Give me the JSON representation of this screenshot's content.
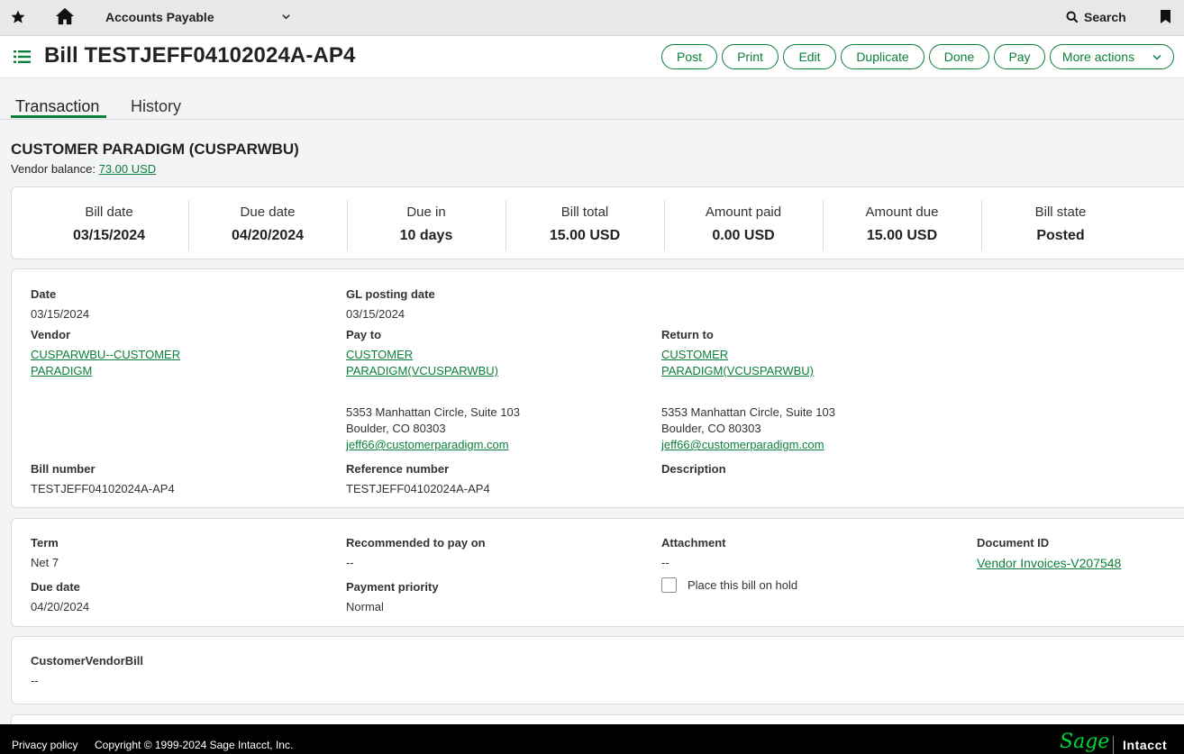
{
  "topbar": {
    "module": "Accounts Payable",
    "search_label": "Search"
  },
  "header": {
    "title": "Bill TESTJEFF04102024A-AP4",
    "actions": [
      "Post",
      "Print",
      "Edit",
      "Duplicate",
      "Done",
      "Pay",
      "More actions"
    ]
  },
  "tabs": [
    "Transaction",
    "History"
  ],
  "vendor": {
    "name": "CUSTOMER PARADIGM (CUSPARWBU)",
    "balance_label": "Vendor balance:",
    "balance_value": "73.00 USD"
  },
  "summary": [
    {
      "label": "Bill date",
      "value": "03/15/2024"
    },
    {
      "label": "Due date",
      "value": "04/20/2024"
    },
    {
      "label": "Due in",
      "value": "10 days"
    },
    {
      "label": "Bill total",
      "value": "15.00 USD"
    },
    {
      "label": "Amount paid",
      "value": "0.00 USD"
    },
    {
      "label": "Amount due",
      "value": "15.00 USD"
    },
    {
      "label": "Bill state",
      "value": "Posted"
    }
  ],
  "details": {
    "date_label": "Date",
    "date_value": "03/15/2024",
    "gl_label": "GL posting date",
    "gl_value": "03/15/2024",
    "vendor_label": "Vendor",
    "vendor_line1": "CUSPARWBU--CUSTOMER",
    "vendor_line2": "PARADIGM",
    "payto_label": "Pay to",
    "payto_line1": "CUSTOMER",
    "payto_line2": "PARADIGM(VCUSPARWBU)",
    "payto_addr1": "5353 Manhattan Circle, Suite 103",
    "payto_addr2": "Boulder, CO 80303",
    "payto_email": "jeff66@customerparadigm.com",
    "returnto_label": "Return to",
    "returnto_line1": "CUSTOMER",
    "returnto_line2": "PARADIGM(VCUSPARWBU)",
    "returnto_addr1": "5353 Manhattan Circle, Suite 103",
    "returnto_addr2": "Boulder, CO 80303",
    "returnto_email": "jeff66@customerparadigm.com",
    "billnum_label": "Bill number",
    "billnum_value": "TESTJEFF04102024A-AP4",
    "refnum_label": "Reference number",
    "refnum_value": "TESTJEFF04102024A-AP4",
    "desc_label": "Description"
  },
  "terms": {
    "term_label": "Term",
    "term_value": "Net 7",
    "rec_label": "Recommended to pay on",
    "rec_value": "--",
    "attach_label": "Attachment",
    "attach_value": "--",
    "docid_label": "Document ID",
    "docid_value": "Vendor Invoices-V207548",
    "due_label": "Due date",
    "due_value": "04/20/2024",
    "priority_label": "Payment priority",
    "priority_value": "Normal",
    "hold_label": "Place this bill on hold",
    "hold_checked": false
  },
  "custom": {
    "label": "CustomerVendorBill",
    "value": "--"
  },
  "footer": {
    "privacy": "Privacy policy",
    "copyright": "Copyright © 1999-2024 Sage Intacct, Inc.",
    "brand_sage": "Sage",
    "brand_intacct": "Intacct"
  },
  "colors": {
    "accent": "#0b7f3c",
    "topbar_bg": "#e6e8ea",
    "footer_bg": "#000000"
  },
  "icons": [
    "star-icon",
    "home-icon",
    "chevron-down-icon",
    "search-icon",
    "bookmark-icon",
    "list-menu-icon",
    "caret-down-icon"
  ]
}
